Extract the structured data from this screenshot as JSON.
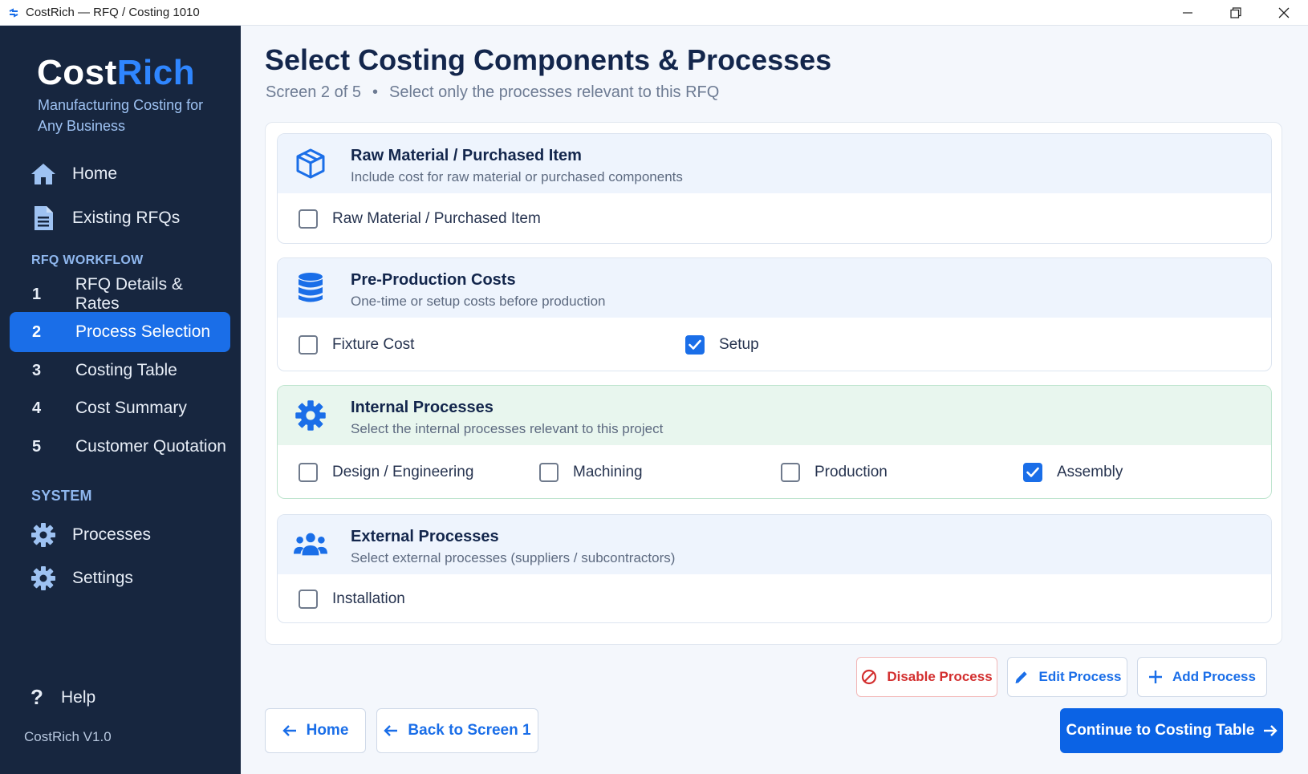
{
  "window": {
    "title": "CostRich — RFQ / Costing 1010"
  },
  "sidebar": {
    "brand_part1": "Cost",
    "brand_part2": "Rich",
    "tagline": "Manufacturing Costing for Any Business",
    "top_nav": [
      {
        "label": "Home",
        "icon": "home-icon"
      },
      {
        "label": "Existing RFQs",
        "icon": "document-icon"
      }
    ],
    "workflow_label": "RFQ WORKFLOW",
    "workflow": [
      {
        "num": "1",
        "label": "RFQ Details & Rates",
        "active": false
      },
      {
        "num": "2",
        "label": "Process Selection",
        "active": true
      },
      {
        "num": "3",
        "label": "Costing Table",
        "active": false
      },
      {
        "num": "4",
        "label": "Cost Summary",
        "active": false
      },
      {
        "num": "5",
        "label": "Customer Quotation",
        "active": false
      }
    ],
    "system_label": "SYSTEM",
    "system": [
      {
        "label": "Processes",
        "icon": "gear-icon"
      },
      {
        "label": "Settings",
        "icon": "gear-icon"
      }
    ],
    "help_label": "Help",
    "version": "CostRich  V1.0"
  },
  "main": {
    "title": "Select Costing Components & Processes",
    "subtitle_screen": "Screen 2 of 5",
    "subtitle_dot": "•",
    "subtitle_hint": "Select only the processes relevant to this RFQ",
    "cards": [
      {
        "title": "Raw Material / Purchased Item",
        "desc": "Include cost for raw material or purchased components",
        "icon": "box-icon",
        "options": [
          {
            "label": "Raw Material / Purchased Item",
            "checked": false
          }
        ]
      },
      {
        "title": "Pre-Production Costs",
        "desc": "One-time or setup costs before production",
        "icon": "database-icon",
        "options": [
          {
            "label": "Fixture Cost",
            "checked": false
          },
          {
            "label": "Setup",
            "checked": true
          }
        ]
      },
      {
        "title": "Internal Processes",
        "desc": "Select the internal processes relevant to this project",
        "icon": "gear-icon",
        "options": [
          {
            "label": "Design / Engineering",
            "checked": false
          },
          {
            "label": "Machining",
            "checked": false
          },
          {
            "label": "Production",
            "checked": false
          },
          {
            "label": "Assembly",
            "checked": true
          }
        ]
      },
      {
        "title": "External Processes",
        "desc": "Select external processes (suppliers / subcontractors)",
        "icon": "users-icon",
        "options": [
          {
            "label": "Installation",
            "checked": false
          }
        ]
      }
    ],
    "actions": {
      "disable": "Disable Process",
      "edit": "Edit Process",
      "add": "Add Process"
    },
    "nav": {
      "home": "Home",
      "back": "Back to Screen 1",
      "continue": "Continue to Costing Table"
    }
  },
  "colors": {
    "sidebar_bg": "#17263f",
    "accent": "#1a6ee8",
    "danger": "#d32f2f",
    "internal_card_bg": "#e8f6ee"
  }
}
